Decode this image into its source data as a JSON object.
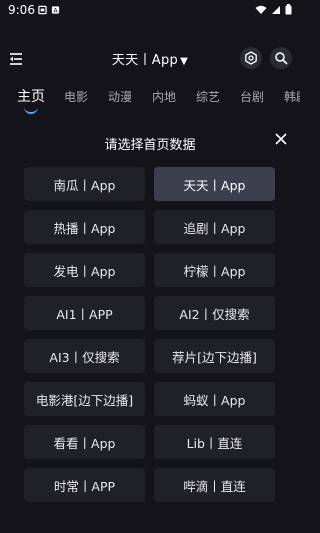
{
  "status": {
    "time": "9:06",
    "icons": [
      "notification-icon",
      "translate-icon",
      "wifi-icon",
      "signal-icon",
      "battery-icon"
    ]
  },
  "header": {
    "title": "天天丨App",
    "dropdown_icon": "▼",
    "icons": [
      "menu-icon",
      "settings-icon",
      "search-icon"
    ]
  },
  "tabs": [
    "主页",
    "电影",
    "动漫",
    "内地",
    "综艺",
    "台剧",
    "韩剧"
  ],
  "active_tab": 0,
  "dialog": {
    "title": "请选择首页数据",
    "close_icon": "close-icon",
    "selected_index": 1,
    "options": [
      "南瓜丨App",
      "天天丨App",
      "热播丨App",
      "追剧丨App",
      "发电丨App",
      "柠檬丨App",
      "AI1丨APP",
      "AI2丨仅搜索",
      "AI3丨仅搜索",
      "荐片[边下边播]",
      "电影港[边下边播]",
      "蚂蚁丨App",
      "看看丨App",
      "Lib丨直连",
      "时常丨APP",
      "哔滴丨直连"
    ]
  },
  "colors": {
    "background": "#131319",
    "button": "#202027",
    "button_selected": "#3d3f4e",
    "accent": "#4aa8ff"
  }
}
